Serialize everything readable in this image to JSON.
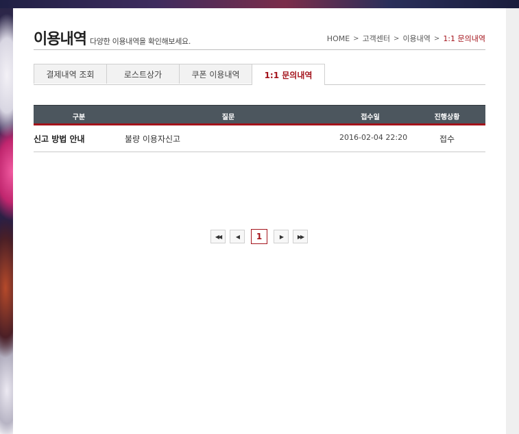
{
  "page": {
    "title": "이용내역",
    "subtitle": "다양한 이용내역을 확인해보세요."
  },
  "breadcrumb": {
    "items": [
      "HOME",
      "고객센터",
      "이용내역",
      "1:1 문의내역"
    ],
    "separator": ">"
  },
  "tabs": [
    {
      "label": "결제내역 조회",
      "active": false
    },
    {
      "label": "로스트상가",
      "active": false
    },
    {
      "label": "쿠폰 이용내역",
      "active": false
    },
    {
      "label": "1:1 문의내역",
      "active": true
    }
  ],
  "table": {
    "headers": [
      "구분",
      "질문",
      "접수일",
      "진행상황"
    ],
    "rows": [
      {
        "category": "신고 방법 안내",
        "question": "불량 이용자신고",
        "date": "2016-02-04 22:20",
        "status": "접수"
      }
    ]
  },
  "pagination": {
    "first_icon": "double-left-arrow-icon",
    "prev_icon": "left-arrow-icon",
    "current_page": "1",
    "next_icon": "right-arrow-icon",
    "last_icon": "double-right-arrow-icon"
  },
  "colors": {
    "accent": "#a3121a",
    "table_header_bg": "#4c565e",
    "tab_bg": "#f2f2f2"
  }
}
